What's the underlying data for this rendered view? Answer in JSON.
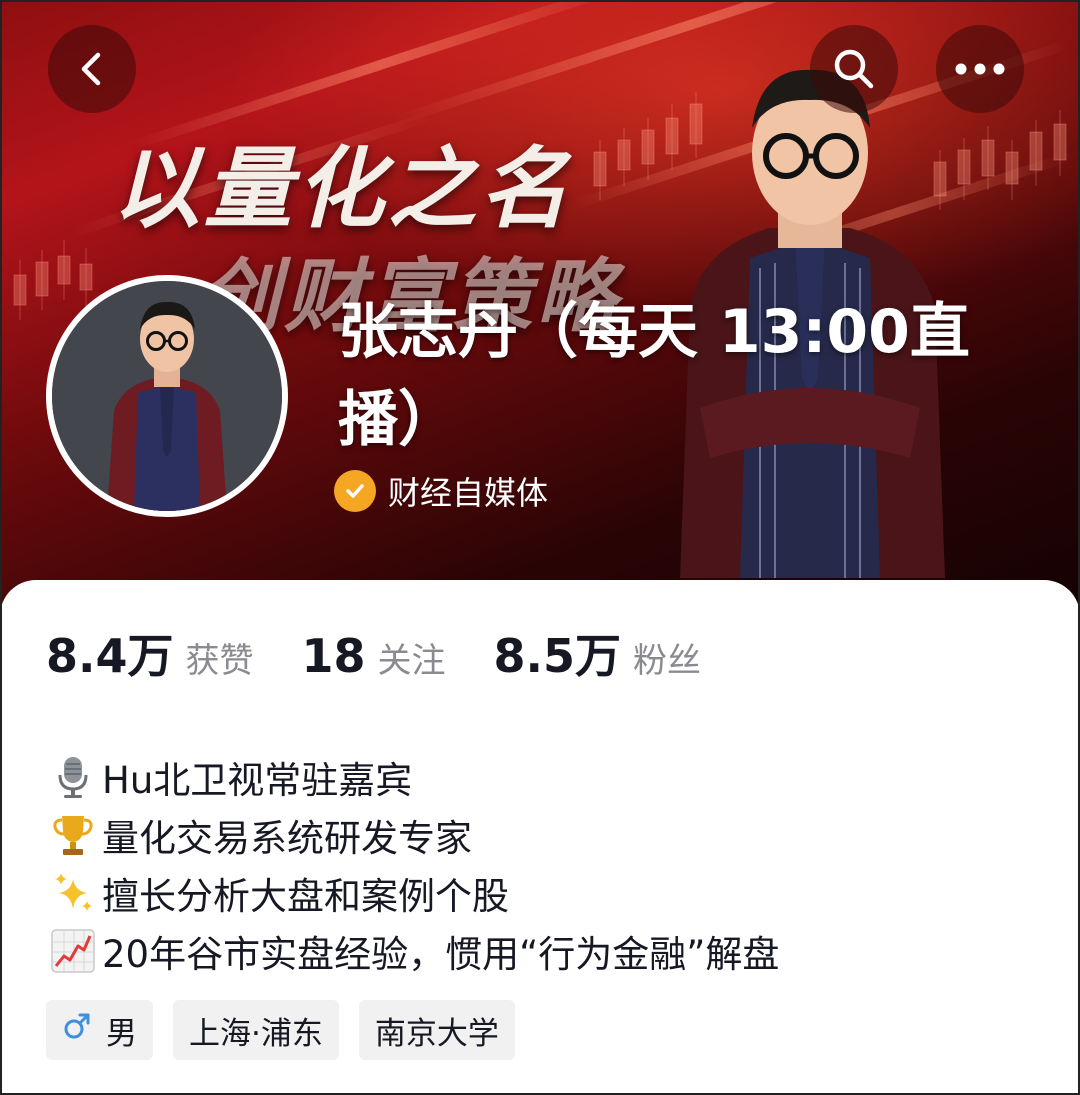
{
  "profile": {
    "name": "张志丹（每天 13:00直播）",
    "verify_label": "财经自媒体"
  },
  "banner": {
    "headline_1": "以量化之名",
    "headline_2": "创财富策略"
  },
  "stats": [
    {
      "value": "8.4万",
      "label": "获赞"
    },
    {
      "value": "18",
      "label": "关注"
    },
    {
      "value": "8.5万",
      "label": "粉丝"
    }
  ],
  "bio": [
    {
      "icon": "microphone-icon",
      "text": "Hu北卫视常驻嘉宾"
    },
    {
      "icon": "trophy-icon",
      "text": "量化交易系统研发专家"
    },
    {
      "icon": "sparkles-icon",
      "text": "擅长分析大盘和案例个股"
    },
    {
      "icon": "chart-increasing-icon",
      "text": "20年谷市实盘经验，惯用“行为金融”解盘"
    }
  ],
  "tags": [
    {
      "icon": "male-icon",
      "text": "男"
    },
    {
      "text": "上海·浦东"
    },
    {
      "text": "南京大学"
    }
  ],
  "colors": {
    "verify_badge": "#f5a623",
    "male_icon": "#3d8fe0",
    "banner_red": "#b3141a"
  }
}
